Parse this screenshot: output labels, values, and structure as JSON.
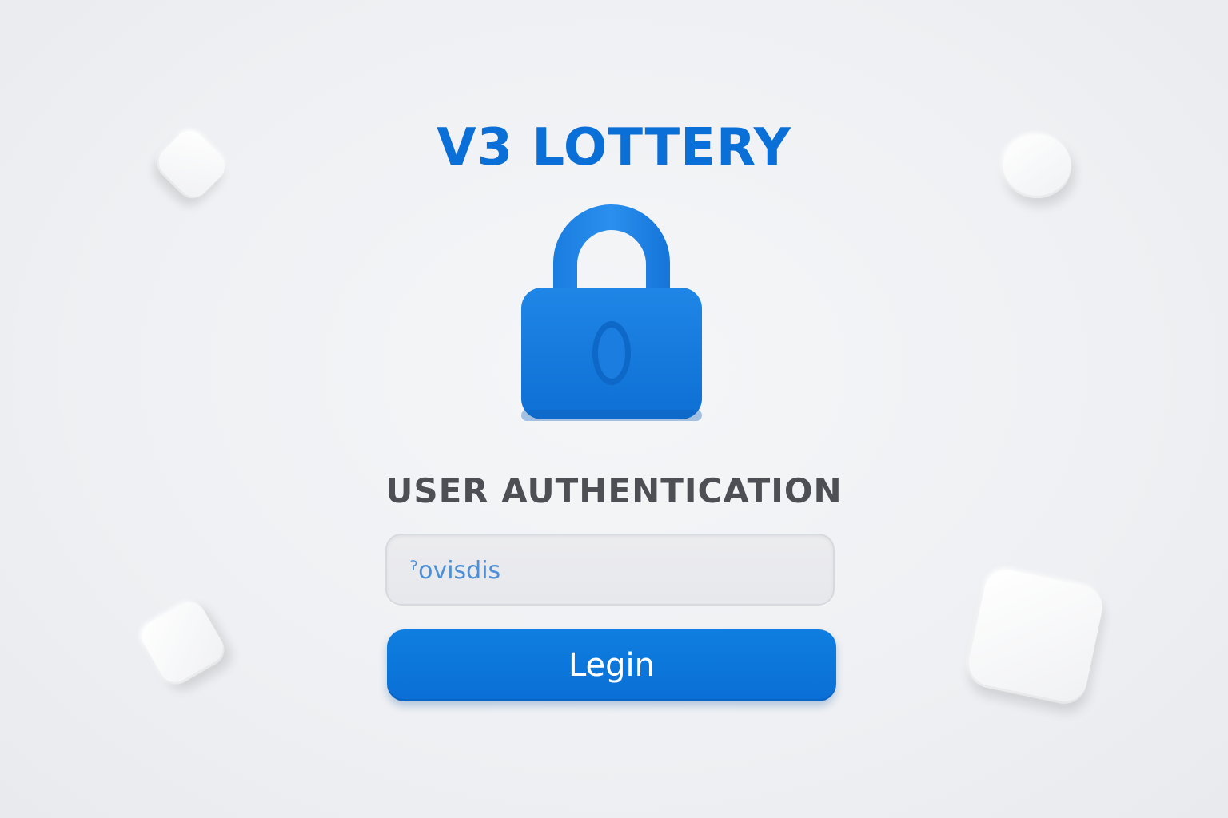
{
  "header": {
    "title": "V3 LOTTERY"
  },
  "icon": {
    "name": "lock-icon"
  },
  "auth": {
    "heading": "USER AUTHENTICATION",
    "input_value": "ˀovisdis",
    "login_label": "Legin"
  },
  "colors": {
    "accent": "#0a6fd6",
    "heading_text": "#4d4f55",
    "background": "#eef0f3"
  },
  "decorations": [
    "rounded-diamond-tile",
    "round-tile",
    "rounded-square-tile",
    "large-rounded-square-tile"
  ]
}
